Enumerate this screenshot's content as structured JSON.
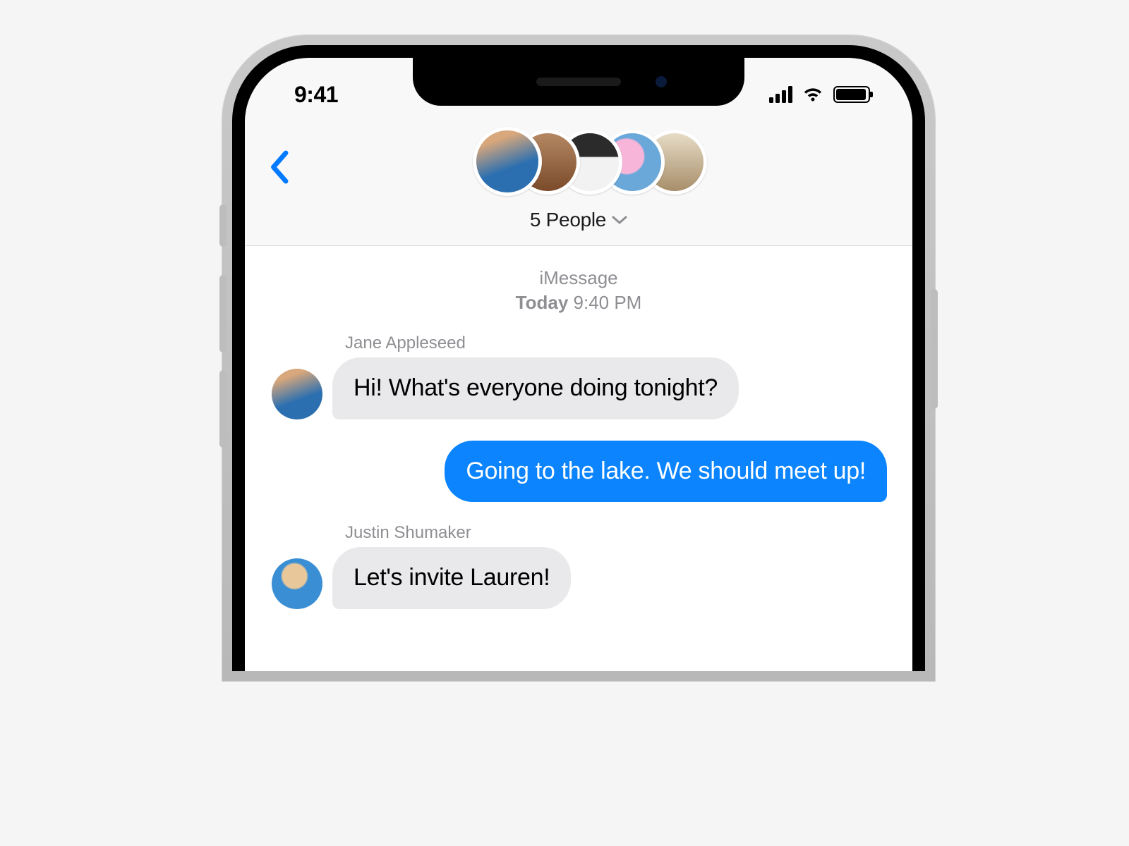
{
  "status": {
    "time": "9:41"
  },
  "header": {
    "group_title": "5 People",
    "avatars": [
      "person1",
      "person2",
      "person3",
      "person4",
      "person5"
    ]
  },
  "thread": {
    "service_label": "iMessage",
    "date_label": "Today",
    "time_label": "9:40 PM",
    "messages": [
      {
        "sender": "Jane Appleseed",
        "text": "Hi! What's everyone doing tonight?",
        "side": "left",
        "avatar": "jane"
      },
      {
        "sender": "me",
        "text": "Going to the lake. We should meet up!",
        "side": "right"
      },
      {
        "sender": "Justin Shumaker",
        "text": "Let's invite Lauren!",
        "side": "left",
        "avatar": "justin"
      }
    ]
  },
  "colors": {
    "blue": "#0b84fe",
    "grey_bubble": "#e9e9eb",
    "header_bg": "#f8f8f9",
    "secondary_text": "#8e8e93"
  }
}
